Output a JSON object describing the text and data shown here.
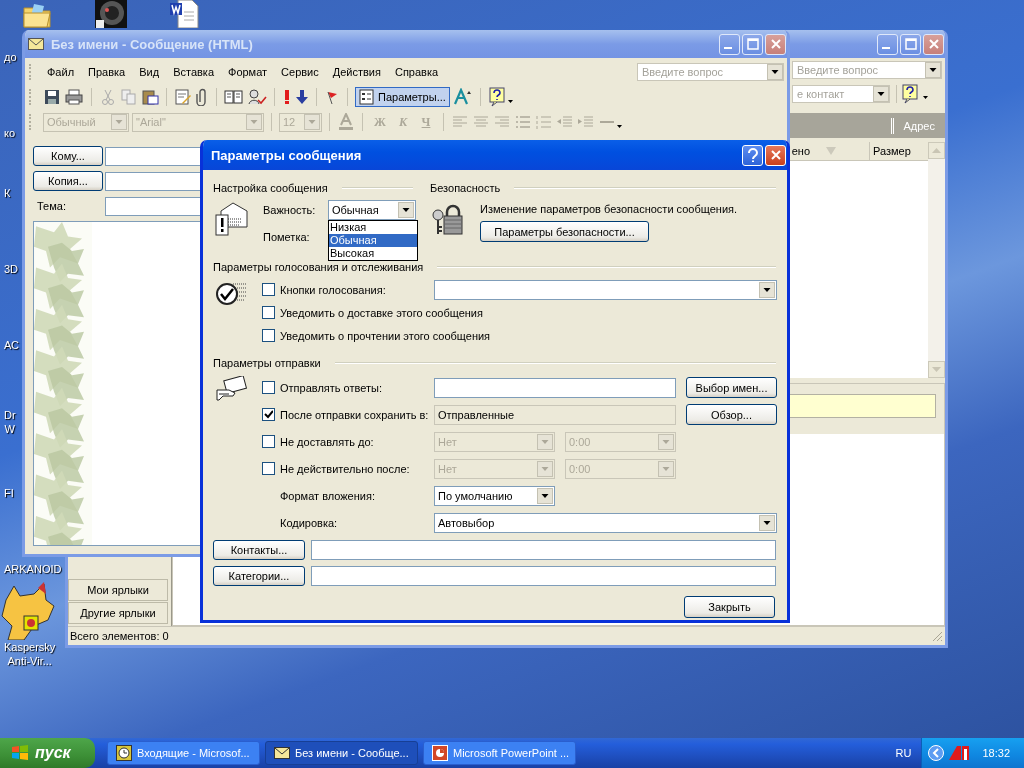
{
  "desktop": {
    "top_icons": [
      {
        "kind": "folder"
      },
      {
        "kind": "disc"
      },
      {
        "kind": "document"
      }
    ],
    "labels": [
      {
        "label": "до"
      },
      {
        "label": "ко"
      },
      {
        "label": "К"
      },
      {
        "label": "3D"
      },
      {
        "label": "АС"
      },
      {
        "label": "Dr W"
      },
      {
        "label": "FI"
      },
      {
        "label": "ARKANOID"
      },
      {
        "label": "Kaspersky Anti-Vir..."
      }
    ]
  },
  "outlook_window": {
    "help_placeholder": "Введите вопрос",
    "contact_placeholder": "е контакт",
    "address_label": "Адрес",
    "columns": [
      "ено",
      "Размер"
    ],
    "shortcuts": [
      "Мои ярлыки",
      "Другие ярлыки"
    ],
    "status": "Всего элементов: 0"
  },
  "message_window": {
    "title": "Без имени - Сообщение (HTML)",
    "menu": [
      "Файл",
      "Правка",
      "Вид",
      "Вставка",
      "Формат",
      "Сервис",
      "Действия",
      "Справка"
    ],
    "help_placeholder": "Введите вопрос",
    "options_button": "Параметры...",
    "format_toolbar": {
      "disabled": true,
      "style": "Обычный",
      "font": "\"Arial\"",
      "size": "12",
      "bold": "Ж",
      "italic": "К",
      "underline": "Ч"
    },
    "fields": [
      {
        "kind": "button",
        "label": "Кому..."
      },
      {
        "kind": "button",
        "label": "Копия..."
      },
      {
        "kind": "label",
        "label": "Тема:"
      }
    ],
    "body": {
      "kind": "picture"
    }
  },
  "dialog": {
    "title": "Параметры сообщения",
    "message_settings": {
      "heading": "Настройка сообщения",
      "importance_label": "Важность:",
      "importance_value": "Обычная",
      "flag_label": "Пометка:",
      "importance_options": [
        {
          "label": "Низкая",
          "selected": false
        },
        {
          "label": "Обычная",
          "selected": true
        },
        {
          "label": "Высокая",
          "selected": false
        }
      ]
    },
    "security": {
      "heading": "Безопасность",
      "text": "Изменение параметров безопасности сообщения.",
      "button": "Параметры безопасности..."
    },
    "voting": {
      "heading": "Параметры голосования и отслеживания",
      "options": [
        {
          "kind": "combo",
          "label": "Кнопки голосования:",
          "checked": false
        },
        {
          "kind": "plain",
          "label": "Уведомить о доставке этого сообщения",
          "checked": false
        },
        {
          "kind": "plain",
          "label": "Уведомить о прочтении этого сообщения",
          "checked": false
        }
      ]
    },
    "sending": {
      "heading": "Параметры отправки",
      "rows": [
        {
          "kind": "field",
          "label": "Отправлять ответы:",
          "checked": false,
          "disabled": false,
          "button": "Выбор имен..."
        },
        {
          "kind": "field",
          "label": "После отправки сохранить в:",
          "checked": true,
          "disabled": true,
          "value": "Отправленные",
          "button": "Обзор..."
        },
        {
          "kind": "datetime",
          "label": "Не доставлять до:",
          "checked": false,
          "disabled": true,
          "date": "Нет",
          "time": "0:00"
        },
        {
          "kind": "datetime",
          "label": "Не действительно после:",
          "checked": false,
          "disabled": true,
          "date": "Нет",
          "time": "0:00"
        },
        {
          "kind": "select",
          "label": "Формат вложения:",
          "disabled": false,
          "wide": false,
          "value": "По умолчанию"
        },
        {
          "kind": "select",
          "label": "Кодировка:",
          "disabled": false,
          "wide": true,
          "value": "Автовыбор"
        }
      ]
    },
    "links": [
      {
        "button": "Контакты..."
      },
      {
        "button": "Категории..."
      }
    ],
    "close_button": "Закрыть"
  },
  "taskbar": {
    "start": "пуск",
    "tasks": [
      {
        "kind": "outlook",
        "label": "Входящие - Microsof...",
        "selected": false
      },
      {
        "kind": "mail",
        "label": "Без имени - Сообще...",
        "selected": true
      },
      {
        "kind": "powerpoint",
        "label": "Microsoft PowerPoint ...",
        "selected": false
      }
    ],
    "language": "RU",
    "clock": "18:32"
  }
}
